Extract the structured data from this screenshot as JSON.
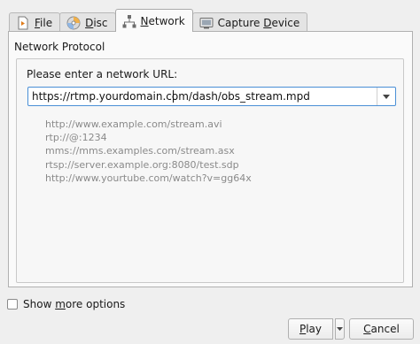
{
  "tabs": [
    {
      "label": "File",
      "mnemonic": "F",
      "rest": "ile",
      "icon": "file-icon",
      "active": false
    },
    {
      "label": "Disc",
      "mnemonic": "D",
      "rest": "isc",
      "icon": "disc-icon",
      "active": false
    },
    {
      "label": "Network",
      "mnemonic": "N",
      "rest": "etwork",
      "icon": "network-icon",
      "active": true
    },
    {
      "label": "Capture Device",
      "pre": "Capture ",
      "mnemonic": "D",
      "rest": "evice",
      "icon": "capture-device-icon",
      "active": false
    }
  ],
  "network": {
    "protocol_label": "Network Protocol",
    "url_label": "Please enter a network URL:",
    "url_value": "https://rtmp.yourdomain.com/dash/obs_stream.mpd",
    "examples": [
      "http://www.example.com/stream.avi",
      "rtp://@:1234",
      "mms://mms.examples.com/stream.asx",
      "rtsp://server.example.org:8080/test.sdp",
      "http://www.yourtube.com/watch?v=gg64x"
    ]
  },
  "footer": {
    "show_more_pre": "Show ",
    "show_more_mnemonic": "m",
    "show_more_post": "ore options",
    "show_more_checked": false,
    "play_pre": "",
    "play_mnemonic": "P",
    "play_post": "lay",
    "cancel_pre": "",
    "cancel_mnemonic": "C",
    "cancel_post": "ancel"
  },
  "colors": {
    "focus_border": "#4a8fd6",
    "example_text": "#8a8a8a"
  }
}
